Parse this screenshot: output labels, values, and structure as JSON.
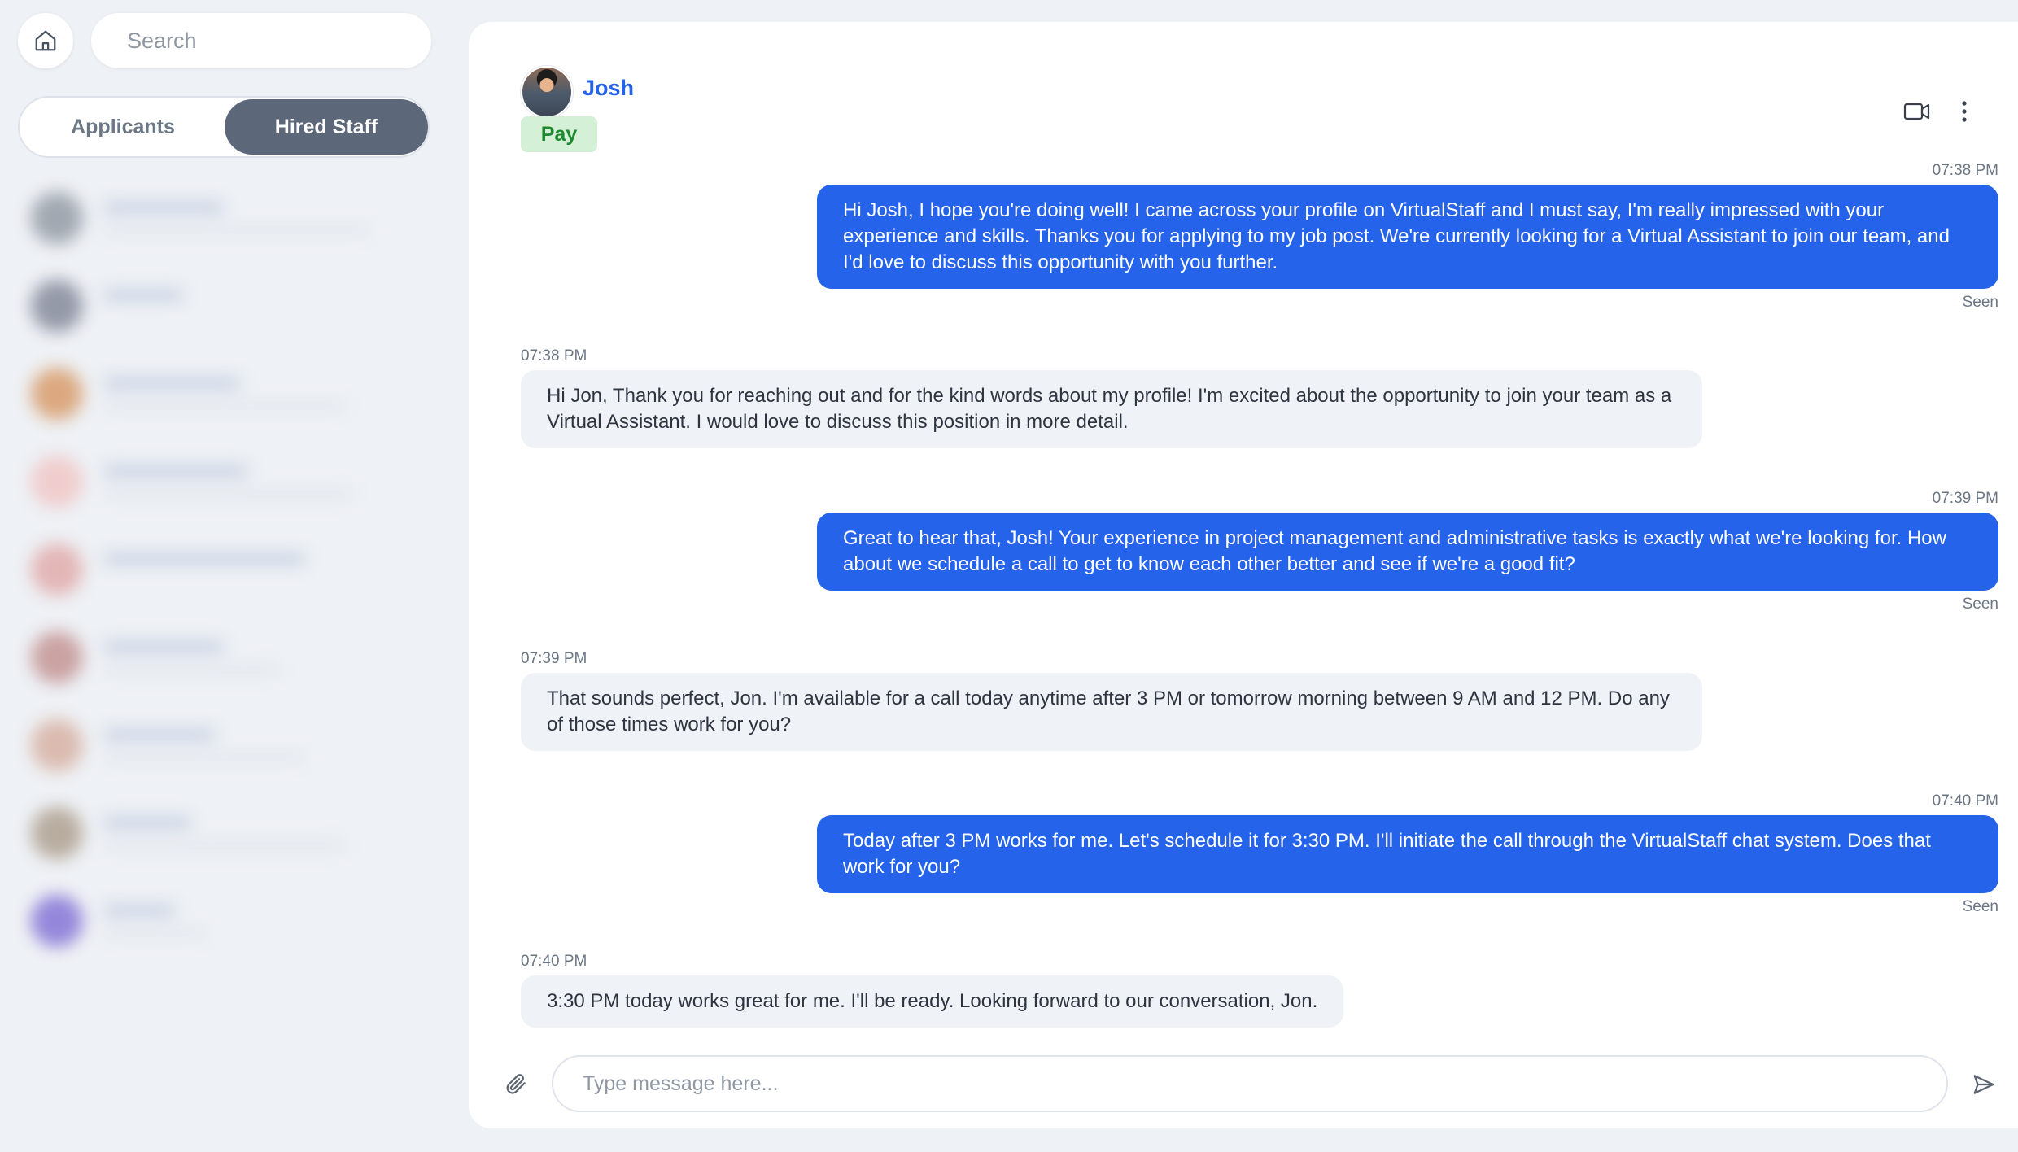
{
  "search": {
    "placeholder": "Search"
  },
  "tabs": [
    {
      "label": "Applicants",
      "active": false
    },
    {
      "label": "Hired Staff",
      "active": true
    }
  ],
  "sidebar_contact_avatar_colors": [
    "#9aa1ab",
    "#8b90a0",
    "#d9a173",
    "#f1c9c9",
    "#e2b0b0",
    "#c79a9a",
    "#d9b5a8",
    "#b3a596",
    "#8b7bd8"
  ],
  "chat": {
    "contact_name": "Josh",
    "pay_label": "Pay",
    "icons": {
      "video": "video-camera-icon",
      "more": "more-vertical-icon",
      "attach": "paperclip-icon",
      "send": "send-icon"
    },
    "accent_color": "#2563eb",
    "messages": [
      {
        "direction": "out",
        "time": "07:38 PM",
        "text": "Hi Josh, I hope you're doing well! I came across your profile on VirtualStaff and I must say, I'm really impressed with your experience and skills. Thanks you for applying to my job post. We're currently looking for a Virtual Assistant to join our team, and I'd love to discuss this opportunity with you further.",
        "status": "Seen"
      },
      {
        "direction": "in",
        "time": "07:38 PM",
        "text": "Hi Jon, Thank you for reaching out and for the kind words about my profile! I'm excited about the opportunity to join your team as a Virtual Assistant. I would love to discuss this position in more detail."
      },
      {
        "direction": "out",
        "time": "07:39 PM",
        "text": "Great to hear that, Josh! Your experience in project management and administrative tasks is exactly what we're looking for. How about we schedule a call to get to know each other better and see if we're a good fit?",
        "status": "Seen"
      },
      {
        "direction": "in",
        "time": "07:39 PM",
        "text": "That sounds perfect, Jon. I'm available for a call today anytime after 3 PM or tomorrow morning between 9 AM and 12 PM. Do any of those times work for you?"
      },
      {
        "direction": "out",
        "time": "07:40 PM",
        "text": "Today after 3 PM works for me. Let's schedule it for 3:30 PM. I'll initiate the call through the VirtualStaff chat system. Does that work for you?",
        "status": "Seen"
      },
      {
        "direction": "in",
        "time": "07:40 PM",
        "text": "3:30 PM today works great for me. I'll be ready. Looking forward to our conversation, Jon."
      }
    ],
    "composer": {
      "placeholder": "Type message here..."
    }
  }
}
